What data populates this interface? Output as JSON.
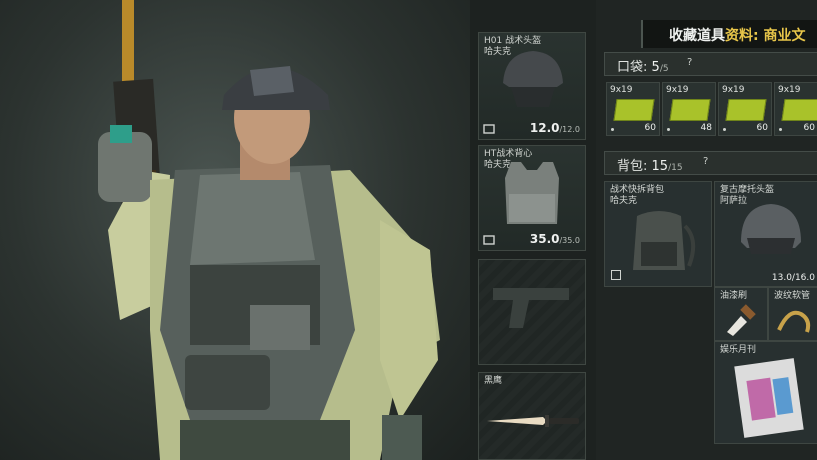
{
  "equipment": {
    "helmet": {
      "name": "H01 战术头盔\n哈夫克",
      "durability": "12.0",
      "durability_max": "/12.0"
    },
    "vest": {
      "name": "HT战术背心\n哈夫克",
      "durability": "35.0",
      "durability_max": "/35.0"
    },
    "pistol_slot": {
      "name": ""
    },
    "melee": {
      "name": "黑鹰"
    }
  },
  "header": {
    "title_prefix": "收藏道具",
    "title_highlight": "资料: 商业文"
  },
  "pockets": {
    "label": "口袋:",
    "count": "5",
    "max": "/5",
    "help": "?"
  },
  "ammo": [
    {
      "label": "9x19",
      "count": "60"
    },
    {
      "label": "9x19",
      "count": "48"
    },
    {
      "label": "9x19",
      "count": "60"
    },
    {
      "label": "9x19",
      "count": "60"
    }
  ],
  "backpack": {
    "label": "背包:",
    "count": "15",
    "max": "/15",
    "help": "?"
  },
  "items": {
    "bag": {
      "name": "战术快拆背包\n哈夫克"
    },
    "helmet2": {
      "name": "复古摩托头盔\n阿萨拉",
      "durability": "13.0/16.0"
    },
    "brush": {
      "name": "油漆刷"
    },
    "hose": {
      "name": "波纹软管"
    },
    "magazine": {
      "name": "娱乐月刊"
    }
  },
  "colors": {
    "accent": "#e8c64a",
    "ammo_box": "#a9c22a"
  }
}
